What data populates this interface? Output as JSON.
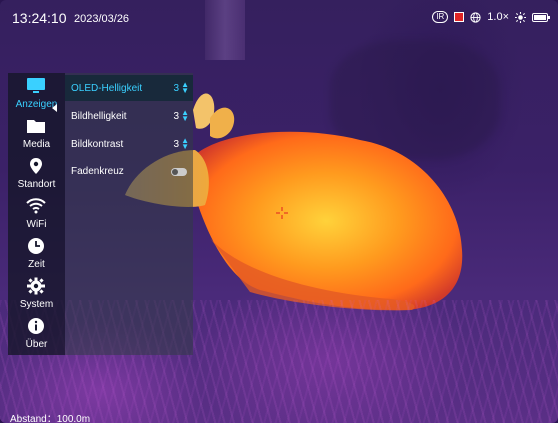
{
  "status": {
    "time": "13:24:10",
    "date": "2023/03/26",
    "ir_badge": "IR",
    "zoom": "1.0×",
    "icons": [
      "ir-badge",
      "record-icon",
      "globe-icon",
      "sun-icon",
      "battery-icon"
    ]
  },
  "sidebar": {
    "items": [
      {
        "label": "Anzeigen",
        "icon": "display-icon",
        "active": true
      },
      {
        "label": "Media",
        "icon": "folder-icon"
      },
      {
        "label": "Standort",
        "icon": "location-icon"
      },
      {
        "label": "WiFi",
        "icon": "wifi-icon"
      },
      {
        "label": "Zeit",
        "icon": "clock-icon"
      },
      {
        "label": "System",
        "icon": "gear-icon"
      },
      {
        "label": "Über",
        "icon": "info-icon"
      }
    ]
  },
  "settings": [
    {
      "label": "OLED-Helligkeit",
      "value": "3",
      "active": true
    },
    {
      "label": "Bildhelligkeit",
      "value": "3"
    },
    {
      "label": "Bildkontrast",
      "value": "3"
    },
    {
      "label": "Fadenkreuz",
      "type": "toggle"
    }
  ],
  "footer": {
    "distance": "Abstand：100.0m"
  },
  "colors": {
    "accent": "#3ad0ff",
    "panel": "#14162a"
  }
}
